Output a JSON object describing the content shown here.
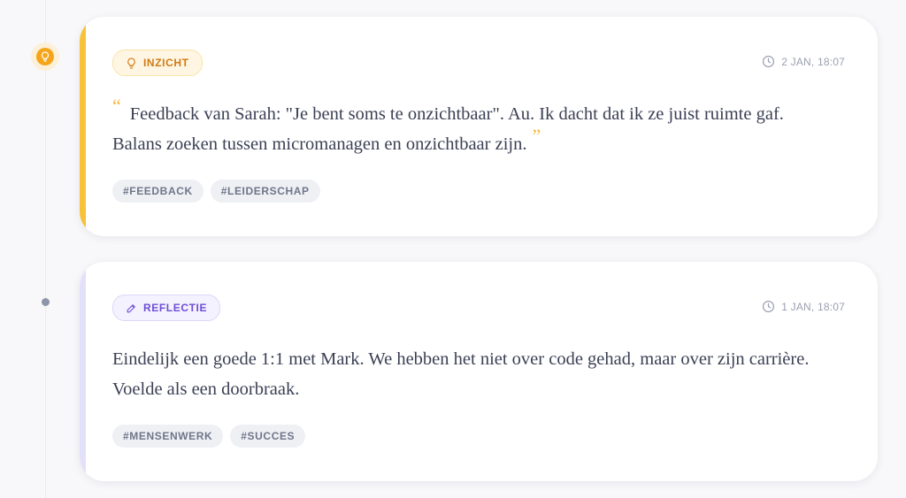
{
  "theme": {
    "accent_inzicht": "#f7c23a",
    "accent_reflectie": "#e3e0fa",
    "badge_inzicht_color": "#d27a12",
    "badge_reflectie_color": "#6d4fd6"
  },
  "entries": [
    {
      "type_label": "INZICHT",
      "type_icon": "lightbulb-icon",
      "timestamp": "2 JAN, 18:07",
      "text_prefix": "Feedback van Sarah: \"Je bent soms te onzichtbaar\". Au. Ik dacht dat ik ze juist ruimte gaf. Balans zoeken tussen micromanagen en onzichtbaar zijn.",
      "quote_open": "“",
      "quote_close": "”",
      "tags": [
        "#FEEDBACK",
        "#LEIDERSCHAP"
      ]
    },
    {
      "type_label": "REFLECTIE",
      "type_icon": "pencil-icon",
      "timestamp": "1 JAN, 18:07",
      "text": "Eindelijk een goede 1:1 met Mark. We hebben het niet over code gehad, maar over zijn carrière. Voelde als een doorbraak.",
      "tags": [
        "#MENSENWERK",
        "#SUCCES"
      ]
    }
  ]
}
